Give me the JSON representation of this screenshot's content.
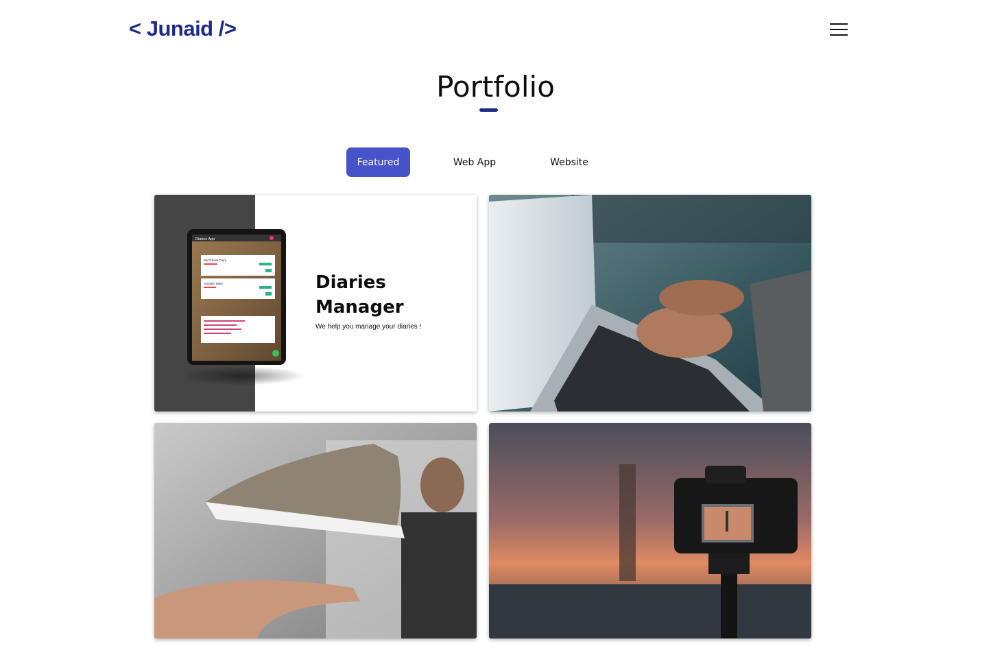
{
  "header": {
    "logo": "< Junaid />",
    "menu_icon": "hamburger-menu-icon"
  },
  "portfolio": {
    "title": "Portfolio",
    "tabs": [
      {
        "label": "Featured",
        "active": true
      },
      {
        "label": "Web App",
        "active": false
      },
      {
        "label": "Website",
        "active": false
      }
    ],
    "projects": [
      {
        "title": "Diaries Manager",
        "subtitle": "We help you manage your diaries !",
        "device_screen": {
          "app_title": "Diaries App",
          "entries": [
            "My Private Diary",
            "Junaid's Diary"
          ]
        }
      },
      {
        "image": "laptop-typing-photo"
      },
      {
        "image": "floating-sneaker-photo"
      },
      {
        "image": "camera-sunset-photo"
      }
    ]
  },
  "colors": {
    "brand": "#1c2a8c",
    "tab_active": "#4753c9"
  }
}
